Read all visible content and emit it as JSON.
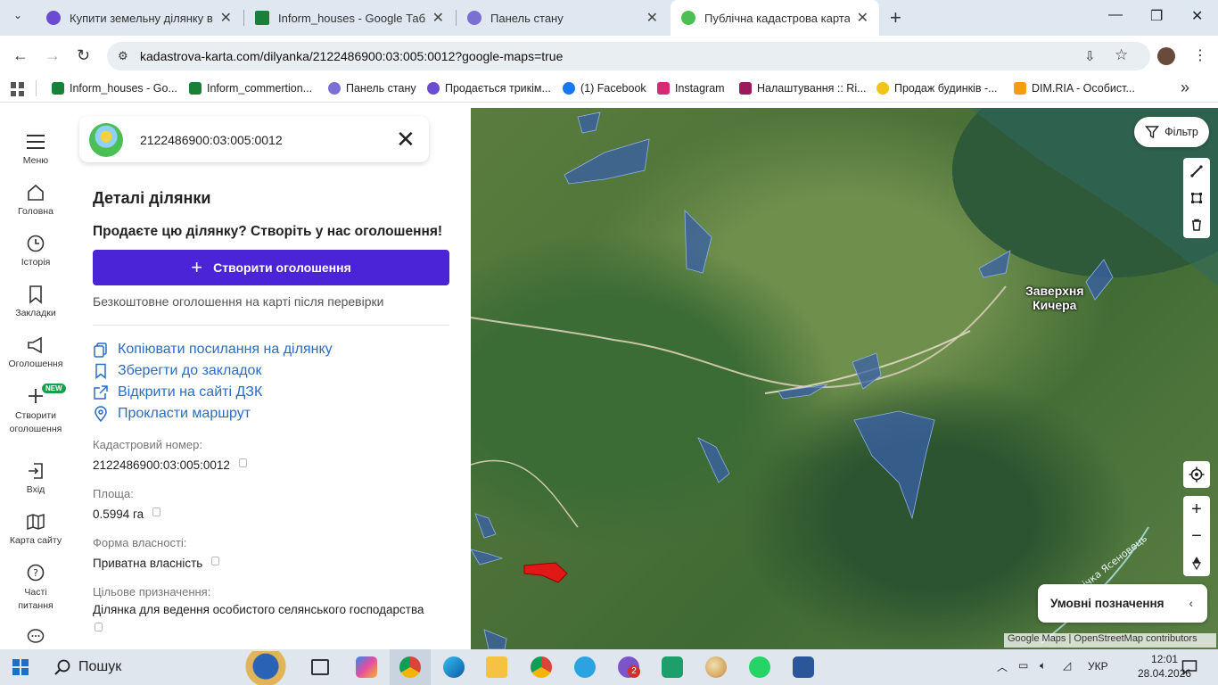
{
  "browser": {
    "tabs": [
      {
        "title": "Купити земельну ділянку в Іва",
        "favicon_color": "#6b4bd1",
        "active": false
      },
      {
        "title": "Inform_houses - Google Табли",
        "favicon_color": "#188038",
        "active": false
      },
      {
        "title": "Панель стану",
        "favicon_color": "#7b6fd6",
        "active": false
      },
      {
        "title": "Публічна кадастрова карта Укр",
        "favicon_color": "#4bbe54",
        "active": true
      }
    ],
    "new_tab": "+",
    "url": "kadastrova-karta.com/dilyanka/2122486900:03:005:0012?google-maps=true",
    "bookmarks": [
      {
        "label": "Inform_houses - Go...",
        "color": "#188038"
      },
      {
        "label": "Inform_commertion...",
        "color": "#188038"
      },
      {
        "label": "Панель стану",
        "color": "#7b6fd6"
      },
      {
        "label": "Продається трикім...",
        "color": "#6b4bd1"
      },
      {
        "label": "(1) Facebook",
        "color": "#1877f2"
      },
      {
        "label": "Instagram",
        "color": "#d62976"
      },
      {
        "label": "Налаштування :: Ri...",
        "color": "#9b1b5a"
      },
      {
        "label": "Продаж будинків -...",
        "color": "#f0c419"
      },
      {
        "label": "DIM.RIA - Особист...",
        "color": "#f39c12"
      }
    ],
    "bookmarks_more": "»"
  },
  "rail": [
    {
      "label": "Меню",
      "icon": "hamburger-icon"
    },
    {
      "label": "Головна",
      "icon": "home-icon"
    },
    {
      "label": "Історія",
      "icon": "clock-icon"
    },
    {
      "label": "Закладки",
      "icon": "bookmark-icon"
    },
    {
      "label": "Оголошення",
      "icon": "megaphone-icon"
    },
    {
      "label": "Створити оголошення",
      "icon": "plus-icon"
    },
    {
      "label": "Вхід",
      "icon": "login-icon"
    },
    {
      "label": "Карта сайту",
      "icon": "map-icon"
    },
    {
      "label": "Часті питання",
      "icon": "help-icon"
    }
  ],
  "new_badge": "NEW",
  "panel": {
    "search_value": "2122486900:03:005:0012",
    "title": "Деталі ділянки",
    "sell_prompt": "Продаєте цю ділянку? Створіть у нас оголошення!",
    "create_button": "Створити оголошення",
    "free_note": "Безкоштовне оголошення на карті після перевірки",
    "actions": [
      {
        "label": "Копіювати посилання на ділянку",
        "icon": "copy-icon"
      },
      {
        "label": "Зберегти до закладок",
        "icon": "bookmark-icon"
      },
      {
        "label": "Відкрити на сайті ДЗК",
        "icon": "external-link-icon"
      },
      {
        "label": "Прокласти маршрут",
        "icon": "pin-icon"
      }
    ],
    "fields": [
      {
        "label": "Кадастровий номер:",
        "value": "2122486900:03:005:0012"
      },
      {
        "label": "Площа:",
        "value": "0.5994 га"
      },
      {
        "label": "Форма власності:",
        "value": "Приватна власність"
      },
      {
        "label": "Цільове призначення:",
        "value": "Ділянка для ведення особистого селянського господарства"
      }
    ]
  },
  "map": {
    "filter_button": "Фільтр",
    "place_label_line1": "Заверхня",
    "place_label_line2": "Кичера",
    "river_label": "річка Ясеновець",
    "legend": "Умовні позначення",
    "attribution": "Google Maps | OpenStreetMap contributors",
    "parcel_color": "#3a5fa8",
    "selected_parcel_color": "#e01818"
  },
  "taskbar": {
    "search": "Пошук",
    "language": "УКР",
    "time": "12:01",
    "date": "28.04.2026",
    "telegram_badge": "2"
  }
}
